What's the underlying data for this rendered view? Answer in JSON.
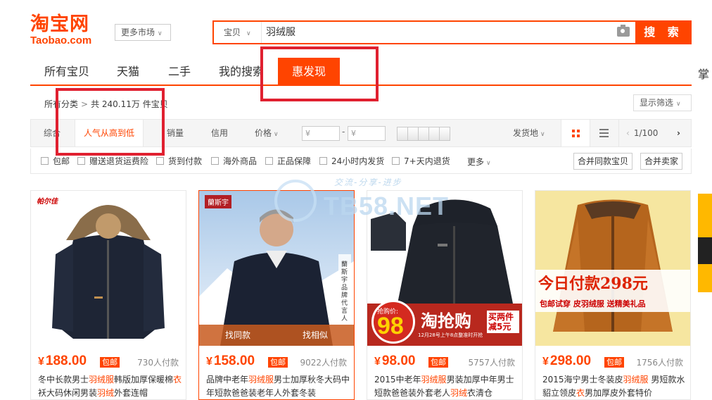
{
  "header": {
    "logo_cn": "淘宝网",
    "logo_en": "Taobao.com",
    "market_label": "更多市场",
    "search_type": "宝贝",
    "search_query": "羽绒服",
    "search_button": "搜 索"
  },
  "tabs": [
    "所有宝贝",
    "天猫",
    "二手",
    "我的搜索",
    "惠发现"
  ],
  "right_cut_label": "掌",
  "breadcrumb": {
    "root": "所有分类",
    "count": "共 240.11万 件宝贝"
  },
  "filter_display": "显示筛选",
  "sortbar": {
    "items": [
      "综合",
      "人气从高到低",
      "销量",
      "信用",
      "价格"
    ],
    "price_from": "¥",
    "price_to": "¥",
    "dash": "-",
    "ship_from": "发货地",
    "page": "1/100"
  },
  "checks": [
    "包邮",
    "赠送退货运费险",
    "货到付款",
    "海外商品",
    "正品保障",
    "24小时内发货",
    "7+天内退货"
  ],
  "more_label": "更多",
  "merge_buttons": [
    "合并同款宝贝",
    "合并卖家"
  ],
  "watermark": {
    "text": "TB58.NET",
    "sub": "交流-分享-进步"
  },
  "products": [
    {
      "price": "188.00",
      "badge": "包邮",
      "sales": "730人付款",
      "brand": "帕尔佳",
      "title_parts": [
        "冬中长款男士",
        "羽绒服",
        "韩版加厚保暖棉",
        "衣",
        "袄大码休闲男装",
        "羽绒",
        "外套连帽"
      ]
    },
    {
      "price": "158.00",
      "badge": "包邮",
      "sales": "9022人付款",
      "brand": "蘭斯宇",
      "brand_slogan": "蘭斯宇品牌代言人",
      "hover_left": "找同款",
      "hover_right": "找相似",
      "title_parts": [
        "品牌中老年",
        "羽绒服",
        "男士加厚秋冬大码",
        "",
        "中年短款爸爸装老年人外套冬装",
        "",
        ""
      ]
    },
    {
      "price": "98.00",
      "badge": "包邮",
      "sales": "5757人付款",
      "promo_big": "淘抢购",
      "promo_price": "98",
      "promo_tag": "抢购价:",
      "promo_right": "买两件减5元",
      "promo_date": "12月28号上午8点整准时开抢",
      "title_parts": [
        "2015中老年",
        "羽绒服",
        "男装加厚中年男士",
        "",
        "短款爸爸装外套老人",
        "羽绒",
        "衣清仓"
      ]
    },
    {
      "price": "298.00",
      "badge": "包邮",
      "sales": "1756人付款",
      "promo_big": "今日付款298元",
      "promo_sub": "包邮试穿 皮羽绒服 送精美礼品",
      "title_parts": [
        "2015海宁男士冬装皮",
        "羽绒服",
        " 男短款水",
        "",
        "貂立领皮",
        "衣",
        "男加厚皮外套特价"
      ]
    }
  ]
}
